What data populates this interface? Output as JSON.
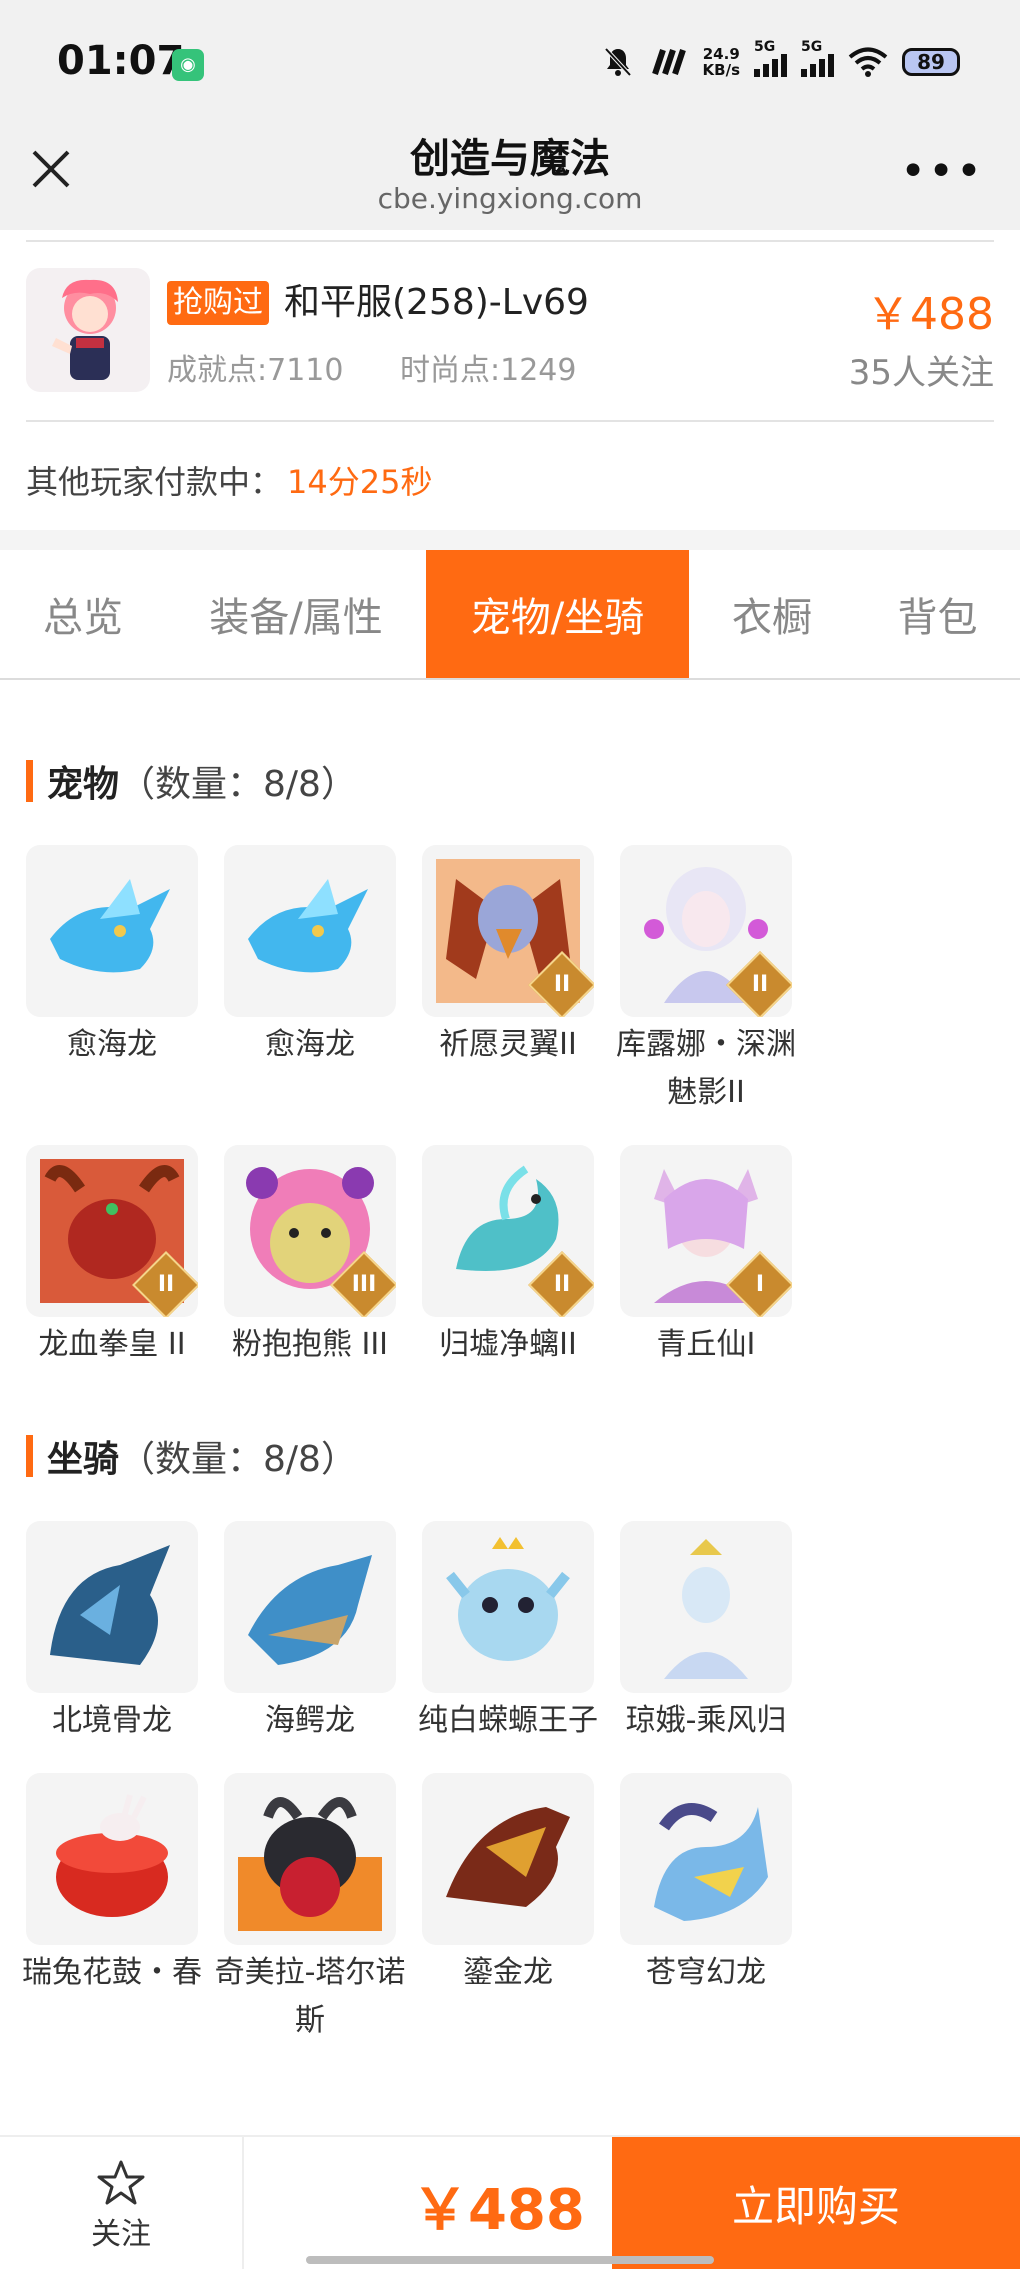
{
  "status_bar": {
    "time": "01:07",
    "net_speed_value": "24.9",
    "net_speed_unit": "KB/s",
    "signal_label_1": "5G",
    "signal_label_2": "5G",
    "battery": "89"
  },
  "nav": {
    "title": "创造与魔法",
    "url": "cbe.yingxiong.com"
  },
  "account": {
    "tag": "抢购过",
    "server": "和平服(258)-Lv69",
    "price": "￥488",
    "achievement": "成就点:7110",
    "fashion": "时尚点:1249",
    "followers": "35人关注"
  },
  "payment": {
    "label": "其他玩家付款中：",
    "time": "14分25秒"
  },
  "tabs": [
    "总览",
    "装备/属性",
    "宠物/坐骑",
    "衣橱",
    "背包"
  ],
  "active_tab": "宠物/坐骑",
  "pets": {
    "title": "宠物",
    "count": "（数量：8/8）",
    "items": [
      {
        "name": "愈海龙",
        "badge": ""
      },
      {
        "name": "愈海龙",
        "badge": ""
      },
      {
        "name": "祈愿灵翼II",
        "badge": "II"
      },
      {
        "name": "库露娜・深渊魅影II",
        "badge": "II"
      },
      {
        "name": "龙血拳皇 II",
        "badge": "II"
      },
      {
        "name": "粉抱抱熊 III",
        "badge": "III"
      },
      {
        "name": "归墟净螭II",
        "badge": "II"
      },
      {
        "name": "青丘仙I",
        "badge": "I"
      }
    ]
  },
  "mounts": {
    "title": "坐骑",
    "count": "（数量：8/8）",
    "items": [
      {
        "name": "北境骨龙"
      },
      {
        "name": "海鳄龙"
      },
      {
        "name": "纯白蝾螈王子"
      },
      {
        "name": "琼娥-乘风归"
      },
      {
        "name": "瑞兔花鼓・春"
      },
      {
        "name": "奇美拉-塔尔诺斯"
      },
      {
        "name": "鎏金龙"
      },
      {
        "name": "苍穹幻龙"
      }
    ]
  },
  "bottom_bar": {
    "follow_label": "关注",
    "price": "￥488",
    "buy_label": "立即购买"
  },
  "colors": {
    "accent": "#ff6a12",
    "background": "#ffffff",
    "gray_bar": "#f1f1f1"
  }
}
